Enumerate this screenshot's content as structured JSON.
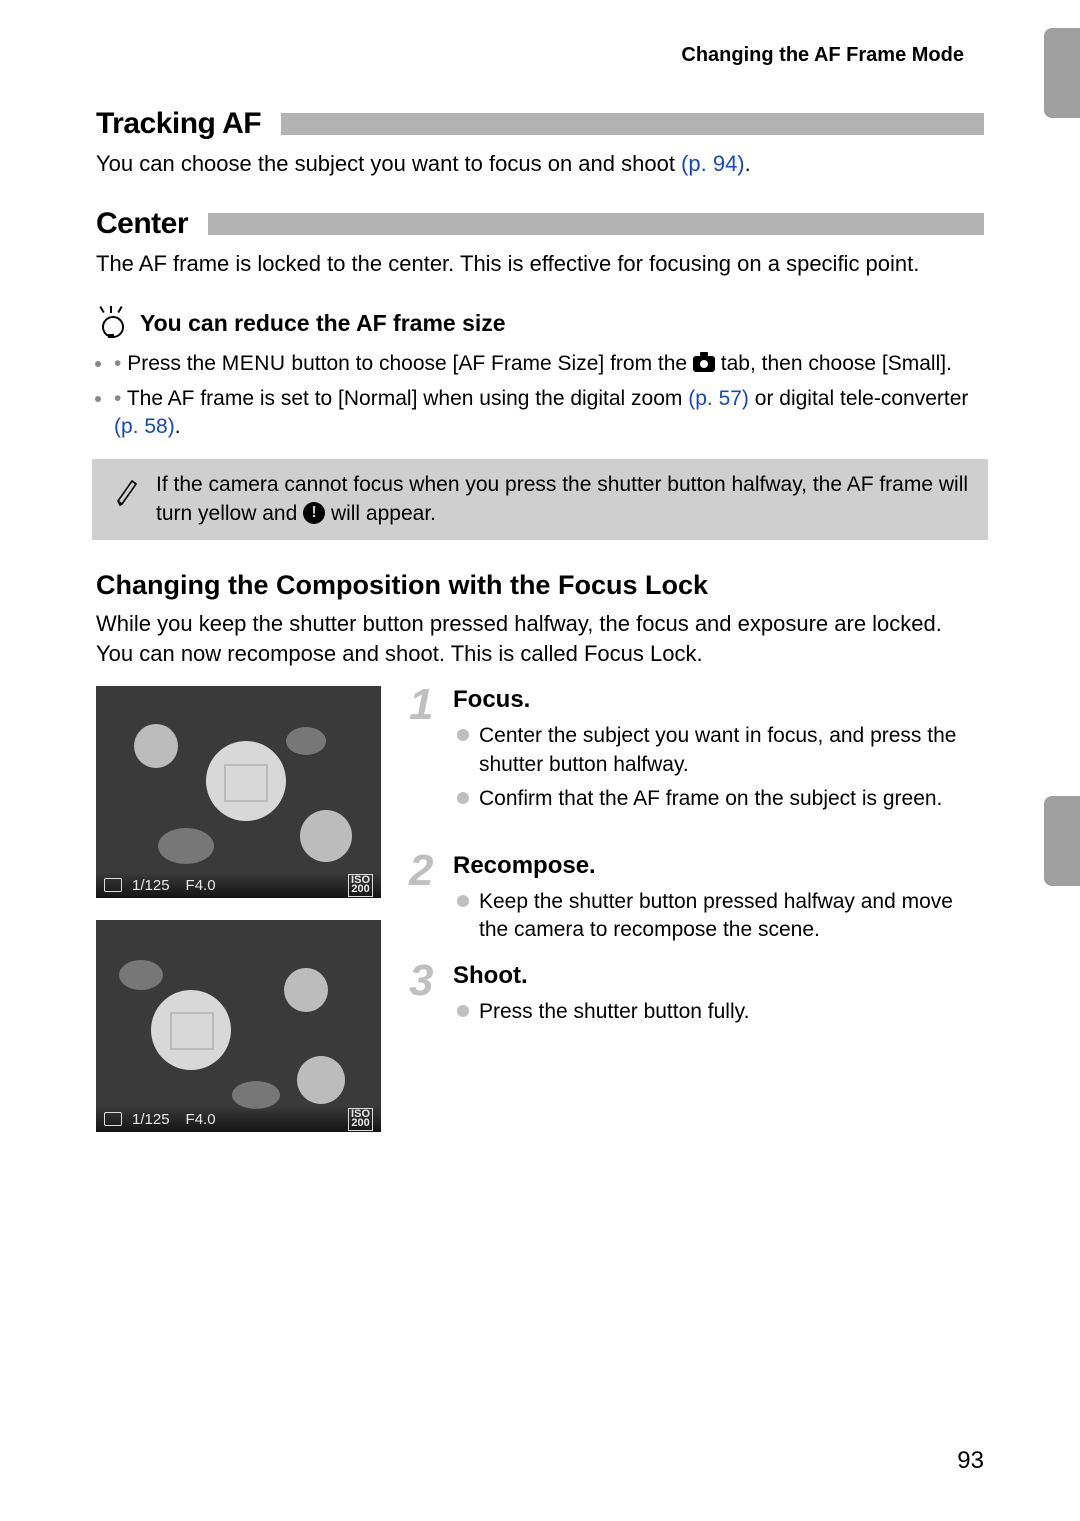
{
  "header": {
    "title": "Changing the AF Frame Mode"
  },
  "sections": {
    "tracking": {
      "heading": "Tracking AF",
      "body_pre": "You can choose the subject you want to focus on and shoot ",
      "link": "(p. 94)",
      "body_post": "."
    },
    "center": {
      "heading": "Center",
      "body": "The AF frame is locked to the center. This is effective for focusing on a specific point."
    }
  },
  "tip": {
    "title": "You can reduce the AF frame size",
    "items": [
      {
        "pre": "Press the ",
        "menu": "MENU",
        "mid": " button to choose [AF Frame Size] from the ",
        "post": " tab, then choose [Small].",
        "has_camera": true
      },
      {
        "pre": "The AF frame is set to [Normal] when using the digital zoom ",
        "link1": "(p. 57)",
        "mid": " or digital tele-converter ",
        "link2": "(p. 58)",
        "post": "."
      }
    ]
  },
  "note": {
    "pre": "If the camera cannot focus when you press the shutter button halfway, the AF frame will turn yellow and ",
    "warn_glyph": "!",
    "post": " will appear."
  },
  "focus_lock": {
    "heading": "Changing the Composition with the Focus Lock",
    "body": "While you keep the shutter button pressed halfway, the focus and exposure are locked. You can now recompose and shoot. This is called Focus Lock."
  },
  "thumbs": {
    "osd_shutter": "1/125",
    "osd_aperture": "F4.0",
    "osd_iso_label": "ISO",
    "osd_iso_value": "200"
  },
  "steps": [
    {
      "num": "1",
      "title": "Focus.",
      "bullets": [
        "Center the subject you want in focus, and press the shutter button halfway.",
        "Confirm that the AF frame on the subject is green."
      ]
    },
    {
      "num": "2",
      "title": "Recompose.",
      "bullets": [
        "Keep the shutter button pressed halfway and move the camera to recompose the scene."
      ]
    },
    {
      "num": "3",
      "title": "Shoot.",
      "bullets": [
        "Press the shutter button fully."
      ]
    }
  ],
  "page_number": "93"
}
